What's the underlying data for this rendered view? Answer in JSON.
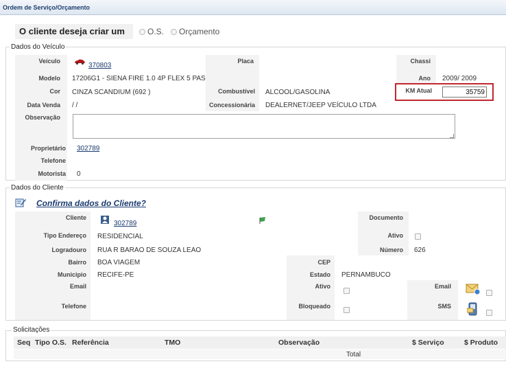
{
  "title": "Ordem de Serviço/Orçamento",
  "question": {
    "label": "O cliente deseja criar um",
    "options": [
      "O.S.",
      "Orçamento"
    ]
  },
  "vehicle": {
    "legend": "Dados do Veículo",
    "veiculo_label": "Veículo",
    "veiculo_value": "370803",
    "placa_label": "Placa",
    "chassi_label": "Chassi",
    "modelo_label": "Modelo",
    "modelo_value": "17206G1 - SIENA FIRE 1.0 4P FLEX 5 PAS",
    "ano_label": "Ano",
    "ano_value": "2009/ 2009",
    "cor_label": "Cor",
    "cor_value": "CINZA SCANDIUM (692 )",
    "combustivel_label": "Combustível",
    "combustivel_value": "ALCOOL/GASOLINA",
    "km_label": "KM Atual",
    "km_value": "35759",
    "data_venda_label": "Data Venda",
    "data_venda_value": "/ /",
    "concessionaria_label": "Concessionária",
    "concessionaria_value": "DEALERNET/JEEP VEÍCULO LTDA",
    "observacao_label": "Observação",
    "proprietario_label": "Proprietário",
    "proprietario_value": "302789",
    "telefone_label": "Telefone",
    "motorista_label": "Motorista",
    "motorista_value": "0"
  },
  "client": {
    "legend": "Dados do Cliente",
    "confirm_link": "Confirma dados do Cliente?",
    "cliente_label": "Cliente",
    "cliente_value": "302789",
    "documento_label": "Documento",
    "tipo_endereco_label": "Tipo Endereço",
    "tipo_endereco_value": "RESIDENCIAL",
    "ativo_label": "Ativo",
    "logradouro_label": "Logradouro",
    "logradouro_value": "RUA R BARAO DE SOUZA LEAO",
    "numero_label": "Número",
    "numero_value": "626",
    "bairro_label": "Bairro",
    "bairro_value": "BOA VIAGEM",
    "cep_label": "CEP",
    "municipio_label": "Municipio",
    "municipio_value": "RECIFE-PE",
    "estado_label": "Estado",
    "estado_value": "PERNAMBUCO",
    "email_label": "Email",
    "ativo2_label": "Ativo",
    "email2_label": "Email",
    "telefone_label": "Telefone",
    "bloqueado_label": "Bloqueado",
    "sms_label": "SMS"
  },
  "requests": {
    "legend": "Solicitações",
    "columns": [
      "Seq",
      "Tipo O.S.",
      "Referência",
      "TMO",
      "Observação",
      "$ Serviço",
      "$ Produto"
    ],
    "total_label": "Total"
  },
  "colors": {
    "highlight": "#c0272d",
    "link": "#1a3a6e",
    "title": "#1f3f6e"
  }
}
